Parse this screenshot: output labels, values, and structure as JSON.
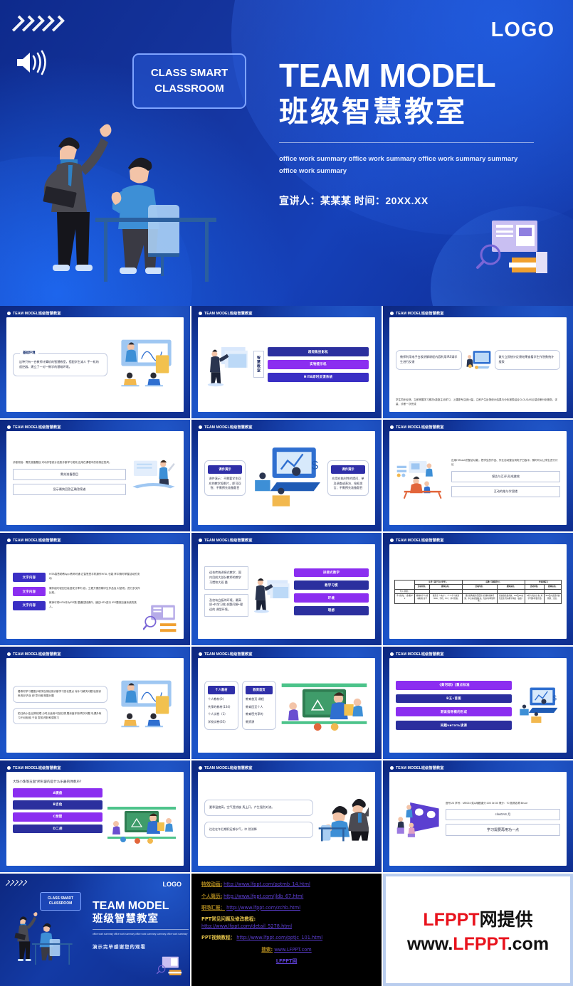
{
  "hero": {
    "logo": "LOGO",
    "badge_line1": "CLASS SMART",
    "badge_line2": "CLASSROOM",
    "title_en": "TEAM MODEL",
    "title_cn": "班级智慧教室",
    "summary": "office work summary office work summary office work summary summary office work summary",
    "presenter": "宣讲人：某某某  时间：20XX.XX"
  },
  "slide_header": "TEAM MODEL班级智慧教室",
  "slides": [
    {
      "id": "slide-basic-environment",
      "tag": "基础环境",
      "body": "这种只有一台教师计算机的智慧教室，搭配学生减人 手一机的遥控器，建立了一对一教学的基础环境。"
    },
    {
      "id": "slide-smart-classroom-devices",
      "vertical_label": "智慧教室",
      "pills": [
        "超短焦投影机",
        "实物提示机",
        "HiTA即时反馈系统"
      ]
    },
    {
      "id": "slide-whiteboard-feedback",
      "box_left": "教师利用电子白板讲解课程内容利用IRS请学生进行反馈",
      "box_right": "散片立即统计反馈结果查看学生作答数统计报表",
      "footer": "学生同步反馈，立即掌握学习概况•激励主动学习，上课更专注统计量，立即产生反馈统计结果与分析报表结合CLOUDAS云端诊断分析服务，评量、诊断一次完成"
    },
    {
      "id": "slide-pre-test",
      "intro": "诊断测验：需先准备题目,可动作答统计信息诊断学习成效,应用在课程中的前测应答风。",
      "boxes": [
        "需先准备题目",
        "显示最快回答正确答案者"
      ]
    },
    {
      "id": "slide-courseware-demo",
      "left_title": "课件演示",
      "left_body": "课件演示：不需要学生回应的教学投影片，即可回答；不需预先准备题目",
      "right_title": "课件演示",
      "right_body": "应用在临时性的提问、单及调查或表决、抢权发言；不需预先准备题目"
    },
    {
      "id": "slide-hiteach-integration",
      "intro": "应用HiTeach的整合功能，把学生的作品、作业自动整合到电子白板中，随时可以让学生进行讨论",
      "boxes": [
        "报告与互评,形成激效",
        "互动的推与学習楼"
      ]
    },
    {
      "id": "slide-text-content-list",
      "items": [
        {
          "tag": "文字内容",
          "color": "pill-indigo",
          "text": "HiTA智慧助教App,教师可通 过智慧型手机操作HiTA ,也能 掌中随时掌握活动的流动"
        },
        {
          "tag": "文字内容",
          "color": "pill-purple",
          "text": "课件组巧轻回已绘回发分享内 容，立更方便的辅字生作品及 对呈现，进行多文件比较。"
        },
        {
          "tag": "文字内容",
          "color": "pill-indigo",
          "text": "教师可将HiTA作为IRS数 据通控制操作，通过HiTA进行 IRS题到加速系统的挑人。"
        }
      ]
    },
    {
      "id": "slide-teaching-model",
      "box1": "适合传统讲授式教学、国内目前大部分教师的教学习惯和大班 量",
      "box2": "及仅有白板的环境，最高质•共学习效,合题问解•理适的 课型环境。",
      "pills": [
        {
          "text": "讲授式教学",
          "color": "pill-purple"
        },
        {
          "text": "教学习惯",
          "color": "pill-navy"
        },
        {
          "text": "环境",
          "color": "pill-purple"
        },
        {
          "text": "理想",
          "color": "pill-navy"
        }
      ]
    },
    {
      "id": "slide-comparison-table",
      "table": {
        "headers": [
          "",
          "先学（基于自主学学）。",
          "后教（讲练结合）。",
          "当堂训练习"
        ],
        "subheaders": [
          "",
          "活动内容。",
          "媒体运用。",
          "活动内容。",
          "媒体运用。",
          "活动内容。",
          "媒体运用。"
        ],
        "rows": [
          [
            "导入 新课。",
            "",
            "",
            "",
            "",
            ".",
            ""
          ],
          [
            "学习新知。（多媒体）2",
            "看教材学习•观看助画 自学",
            "投影室（*电子）、*个人学习资源（PAD、手机、PC）、参考答案。",
            "课堂经典/批准回目针对讲解•媒体问题、争点拓/质疑补充、知识巩/再现同能。",
            "投放软表板系统、IRS及RS交互反馈 互动教学系统（白板）",
            "#练习(知识分化) 用学问题/评量计量)",
            "IRS及时反馈系统 查纲、分组。"
          ]
        ]
      }
    },
    {
      "id": "slide-self-learning",
      "box1": "看教材学习看图示助学自测检测诊断学习变化提点 对补习解决问题 检测训练/知识内化 即 导问难/拓展分题",
      "box2": "拓归纳小结,结构梳理 分时点适用/可回归课 展深度评测/再次问题 巩课外练习/行动检验 干自 发知识配/和课拓习"
    },
    {
      "id": "slide-resources",
      "card1_title": "个人教材",
      "card1_items": [
        "个人教材(0)",
        "共享的教材(134)",
        "个人试卷（1）",
        "学校试卷(65)"
      ],
      "card2_title": "教育首页",
      "card2_items": [
        "教育首页 课程",
        "教育回至个人",
        "教育密共享的",
        "教资源"
      ]
    },
    {
      "id": "slide-lesson-flow",
      "pills": [
        {
          "text": "《黄河颂》[重点标准",
          "color": "pill-purple"
        },
        {
          "text": "B五•首图",
          "color": "pill-navy"
        },
        {
          "text": "测读指导模的形成",
          "color": "pill-purple"
        },
        {
          "text": "间题читать读课",
          "color": "pill-navy"
        }
      ]
    },
    {
      "id": "slide-quiz",
      "question": "大珠小珠落玉盘\"所形容的是什么乐器的弹奏声?",
      "options": [
        {
          "text": "A键盘",
          "color": "pill-purple"
        },
        {
          "text": "B吉他",
          "color": "pill-navy"
        },
        {
          "text": "C琵琶",
          "color": "pill-purple"
        },
        {
          "text": "D二胡",
          "color": "pill-navy"
        }
      ]
    },
    {
      "id": "slide-weather",
      "box1": "夏季温度高，空气受热後 馬上开，产生强烈对流。",
      "box2": "往往在午后期积足够水气，冲 然消降"
    },
    {
      "id": "slide-score",
      "intro": "座号:23 学号：ME024   姓&用题道分:100  3e:30  得分：70   施測名称:Bruce",
      "boxes": [
        "clouDAS 月",
        "学习需要再用功一点"
      ]
    }
  ],
  "footer_links": {
    "items": [
      {
        "label": "特效动画:",
        "url": "http://www.lfppt.com/pptmb_14.html"
      },
      {
        "label": "个人简历:",
        "url": "http://www.lfppt.com/jldb_67.html"
      },
      {
        "label": "职场汇报：",
        "url": "http://www.lfppt.com/zchb.html"
      }
    ],
    "faq_label": "PPT常见问题及修改教程:",
    "faq_url": "http://www.lfppt.com/detail_5278.html",
    "video_label": "PPT视频教程：",
    "video_url": "http://www.lfppt.com/pptjc_101.html",
    "search_label": "搜索:",
    "search_url": "www.LFPPT.com",
    "site_name": "LFPPT网"
  },
  "watermark": {
    "line1_red": "LFPPT",
    "line1_black": "网提供",
    "line2_a": "www.",
    "line2_red": "LFPPT",
    "line2_b": ".com"
  },
  "last_slide": {
    "logo": "LOGO",
    "badge_line1": "CLASS SMART",
    "badge_line2": "CLASSROOM",
    "title_en": "TEAM MODEL",
    "title_cn": "班级智慧教室",
    "summary": "office work summary office work summary office work summary summary office work summary",
    "thanks": "演示完毕感谢您的观看"
  },
  "colors": {
    "brand_blue": "#133aa5",
    "accent_purple": "#8b2ef0",
    "accent_indigo": "#2b2f9e",
    "link_purple": "#5d3fd3",
    "gold": "#c9a227",
    "red": "#e8121c"
  }
}
